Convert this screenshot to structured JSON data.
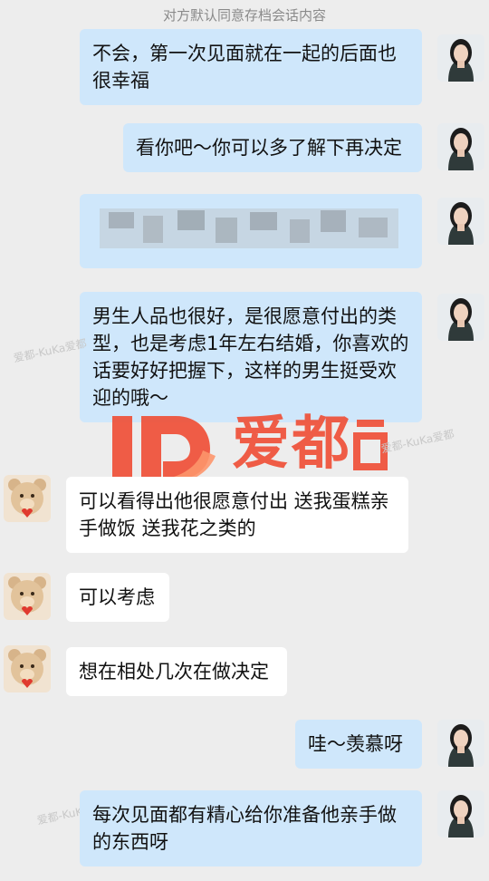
{
  "notice": "对方默认同意存档会话内容",
  "watermark": {
    "brand": "爱都",
    "accent_color": "#f0492f",
    "faint_text": "爱都-KuKa爱都"
  },
  "messages": [
    {
      "side": "right",
      "text": "不会，第一次见面就在一起的后面也很幸福"
    },
    {
      "side": "right",
      "text": "看你吧～你可以多了解下再决定"
    },
    {
      "side": "right",
      "text": ""
    },
    {
      "side": "right",
      "text": "男生人品也很好，是很愿意付出的类型，也是考虑1年左右结婚，你喜欢的话要好好把握下，这样的男生挺受欢迎的哦～"
    },
    {
      "side": "left",
      "text": "可以看得出他很愿意付出 送我蛋糕亲手做饭 送我花之类的"
    },
    {
      "side": "left",
      "text": "可以考虑"
    },
    {
      "side": "left",
      "text": "想在相处几次在做决定"
    },
    {
      "side": "right",
      "text": "哇～羡慕呀"
    },
    {
      "side": "right",
      "text": "每次见面都有精心给你准备他亲手做的东西呀"
    }
  ],
  "colors": {
    "outgoing_bubble": "#cfe7fb",
    "incoming_bubble": "#ffffff",
    "background": "#ededed"
  }
}
